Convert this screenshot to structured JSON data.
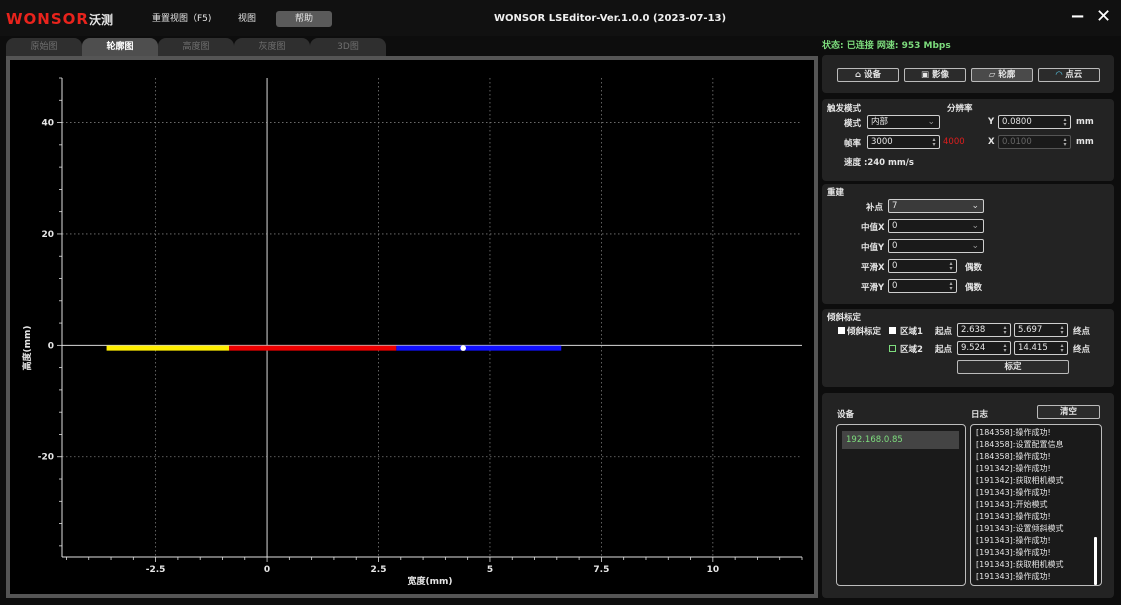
{
  "app": {
    "logo": "WONSOR",
    "logo_cn": "沃测",
    "title": "WONSOR LSEditor-Ver.1.0.0 (2023-07-13)",
    "menu": [
      "重置视图（F5)",
      "视图",
      "帮助"
    ],
    "minimize": "−",
    "close": "✕"
  },
  "tabs": [
    "原始图",
    "轮廓图",
    "高度图",
    "灰度图",
    "3D图"
  ],
  "status": "状态: 已连接 网速: 953 Mbps",
  "nav_buttons": [
    "设备",
    "影像",
    "轮廓",
    "点云"
  ],
  "trigger": {
    "section": "触发模式",
    "mode_label": "模式",
    "mode_value": "内部",
    "rate_label": "帧率",
    "rate_value": "3000",
    "rate_max": "4000",
    "speed": "速度 :240 mm/s"
  },
  "resolution": {
    "section": "分辨率",
    "y_label": "Y",
    "y_value": "0.0800",
    "x_label": "X",
    "x_value": "0.0100",
    "unit": "mm"
  },
  "rebuild": {
    "section": "重建",
    "rows": [
      {
        "label": "补点",
        "value": "7"
      },
      {
        "label": "中值X",
        "value": "0"
      },
      {
        "label": "中值Y",
        "value": "0"
      },
      {
        "label": "平滑X",
        "value": "0"
      },
      {
        "label": "平滑Y",
        "value": "0"
      }
    ],
    "even": "偶数"
  },
  "tilt": {
    "section": "倾斜标定",
    "enable_label": "倾斜标定",
    "region1": "区域1",
    "region2": "区域2",
    "start": "起点",
    "end": "终点",
    "r1_start": "2.638",
    "r1_end": "5.697",
    "r2_start": "9.524",
    "r2_end": "14.415",
    "calibrate": "标定"
  },
  "bottom": {
    "device_label": "设备",
    "log_label": "日志",
    "clear": "清空",
    "device_ip": "192.168.0.85",
    "logs": [
      "[184358]:操作成功!",
      "[184358]:设置配置信息",
      "[184358]:操作成功!",
      "[191342]:操作成功!",
      "[191342]:获取相机模式",
      "[191343]:操作成功!",
      "[191343]:开始模式",
      "[191343]:操作成功!",
      "[191343]:设置倾斜模式",
      "[191343]:操作成功!",
      "[191343]:操作成功!",
      "[191343]:获取相机模式",
      "[191343]:操作成功!"
    ]
  },
  "chart_data": {
    "type": "line",
    "xlabel": "宽度(mm)",
    "ylabel": "高度(mm)",
    "xlim": [
      -4.6,
      12.0
    ],
    "ylim": [
      -38,
      48
    ],
    "xticks": [
      -2.5,
      0,
      2.5,
      5,
      7.5,
      10
    ],
    "xtick_labels": [
      "-2.5",
      "0",
      "2.5",
      "5",
      "7.5",
      "10"
    ],
    "yticks": [
      -20,
      0,
      20,
      40
    ],
    "ytick_labels": [
      "-20",
      "0",
      "20",
      "40"
    ],
    "grid": true,
    "series": [
      {
        "color": "#ffee00",
        "x": [
          -3.6,
          -0.85
        ],
        "y": [
          -0.5,
          -0.5
        ]
      },
      {
        "color": "#ee0000",
        "x": [
          -0.85,
          2.9
        ],
        "y": [
          -0.5,
          -0.5
        ]
      },
      {
        "color": "#1010ff",
        "x": [
          2.9,
          6.6
        ],
        "y": [
          -0.5,
          -0.5
        ]
      }
    ],
    "marker": {
      "x": 4.4,
      "y": -0.5,
      "color": "#ffffff"
    }
  }
}
